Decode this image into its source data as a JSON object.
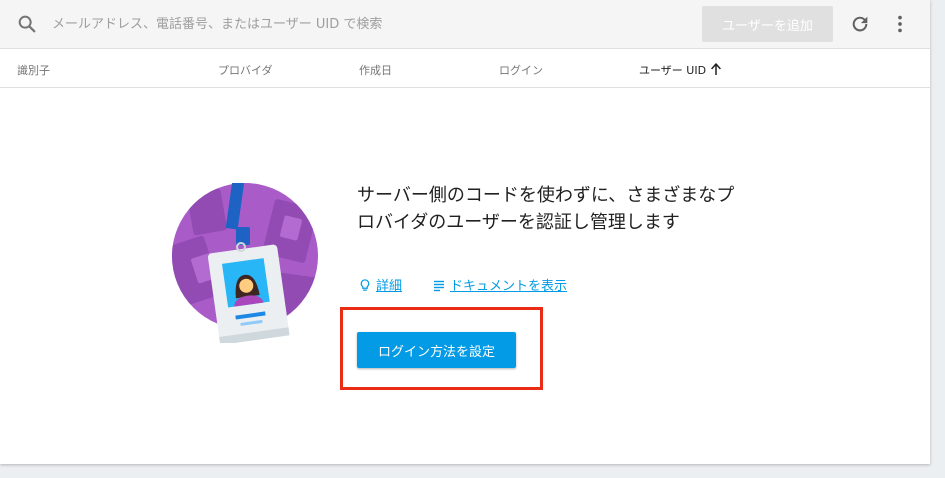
{
  "toolbar": {
    "search_placeholder": "メールアドレス、電話番号、またはユーザー UID で検索",
    "add_user_label": "ユーザーを追加",
    "icons": {
      "search": "search-icon",
      "refresh": "refresh-icon",
      "more": "more-vert-icon"
    }
  },
  "table": {
    "columns": [
      "識別子",
      "プロバイダ",
      "作成日",
      "ログイン",
      "ユーザー UID"
    ],
    "sorted_column": "ユーザー UID",
    "sort_direction": "ascending"
  },
  "empty_state": {
    "headline": "サーバー側のコードを使わずに、さまざまなプロバイダのユーザーを認証し管理します",
    "links": [
      {
        "label": "詳細",
        "icon": "lightbulb-icon"
      },
      {
        "label": "ドキュメントを表示",
        "icon": "notes-icon"
      }
    ],
    "setup_button_label": "ログイン方法を設定"
  },
  "colors": {
    "accent": "#039be5",
    "highlight": "#ea2b16",
    "illustration_bg": "#a95cc8",
    "disabled_button": "#e0e0e0"
  }
}
